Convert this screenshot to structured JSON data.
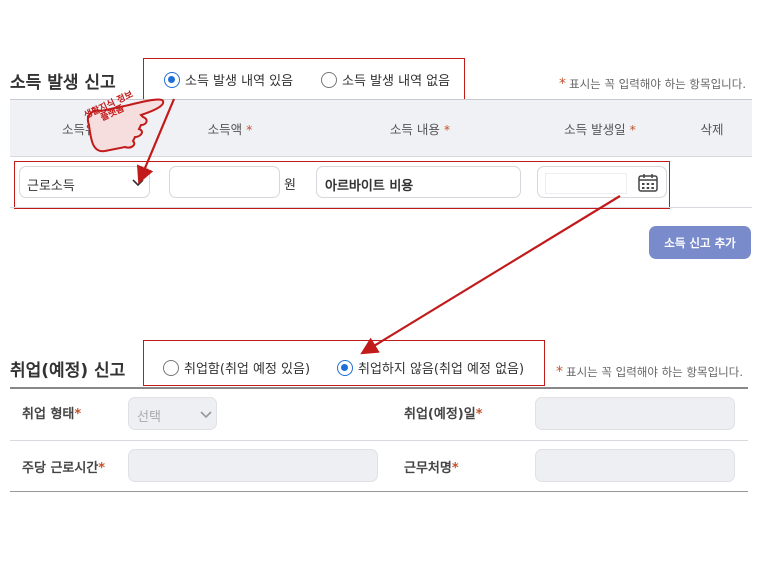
{
  "income_section": {
    "title": "소득 발생 신고",
    "options": [
      {
        "label": "소득 발생 내역 있음",
        "selected": true
      },
      {
        "label": "소득 발생 내역 없음",
        "selected": false
      }
    ],
    "required_note": "표시는 꼭 입력해야 하는 항목입니다.",
    "columns": [
      "소득유형",
      "소득액",
      "소득 내용",
      "소득 발생일",
      "삭제"
    ],
    "row": {
      "type_value": "근로소득",
      "amount_value": "",
      "amount_unit": "원",
      "content_value": "아르바이트 비용",
      "date_value": ""
    },
    "add_button": "소득 신고 추가"
  },
  "annotation": {
    "stamp_text": "생활지식 정보 플랫폼"
  },
  "employment_section": {
    "title": "취업(예정) 신고",
    "options": [
      {
        "label": "취업함(취업 예정 있음)",
        "selected": false
      },
      {
        "label": "취업하지 않음(취업 예정 없음)",
        "selected": true
      }
    ],
    "required_note": "표시는 꼭 입력해야 하는 항목입니다.",
    "fields": {
      "type_label": "취업 형태",
      "type_placeholder": "선택",
      "date_label": "취업(예정)일",
      "hours_label": "주당 근로시간",
      "workplace_label": "근무처명"
    }
  },
  "colors": {
    "accent_blue": "#1e6fd9",
    "annotation_red": "#c21a1a",
    "required_star": "#c0532b",
    "add_button_bg": "#7a8bcc"
  }
}
